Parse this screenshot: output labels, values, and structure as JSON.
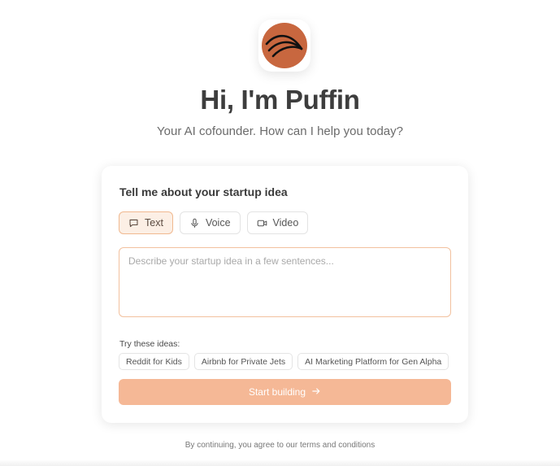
{
  "hero": {
    "logo_icon": "puffin-logo-icon",
    "title": "Hi, I'm Puffin",
    "subtitle": "Your AI cofounder. How can I help you today?"
  },
  "card": {
    "title": "Tell me about your startup idea",
    "modes": [
      {
        "label": "Text",
        "icon": "message-square-icon",
        "active": true
      },
      {
        "label": "Voice",
        "icon": "microphone-icon",
        "active": false
      },
      {
        "label": "Video",
        "icon": "video-camera-icon",
        "active": false
      }
    ],
    "input": {
      "value": "",
      "placeholder": "Describe your startup idea in a few sentences..."
    },
    "try_label": "Try these ideas:",
    "ideas": [
      "Reddit for Kids",
      "Airbnb for Private Jets",
      "AI Marketing Platform for Gen Alpha"
    ],
    "start_button": "Start building"
  },
  "footer": {
    "terms": "By continuing, you agree to our terms and conditions"
  },
  "colors": {
    "accent": "#f5b896",
    "logo_bg": "#c8673f",
    "active_tab_bg": "#fcefe5",
    "active_tab_border": "#f0b990"
  }
}
